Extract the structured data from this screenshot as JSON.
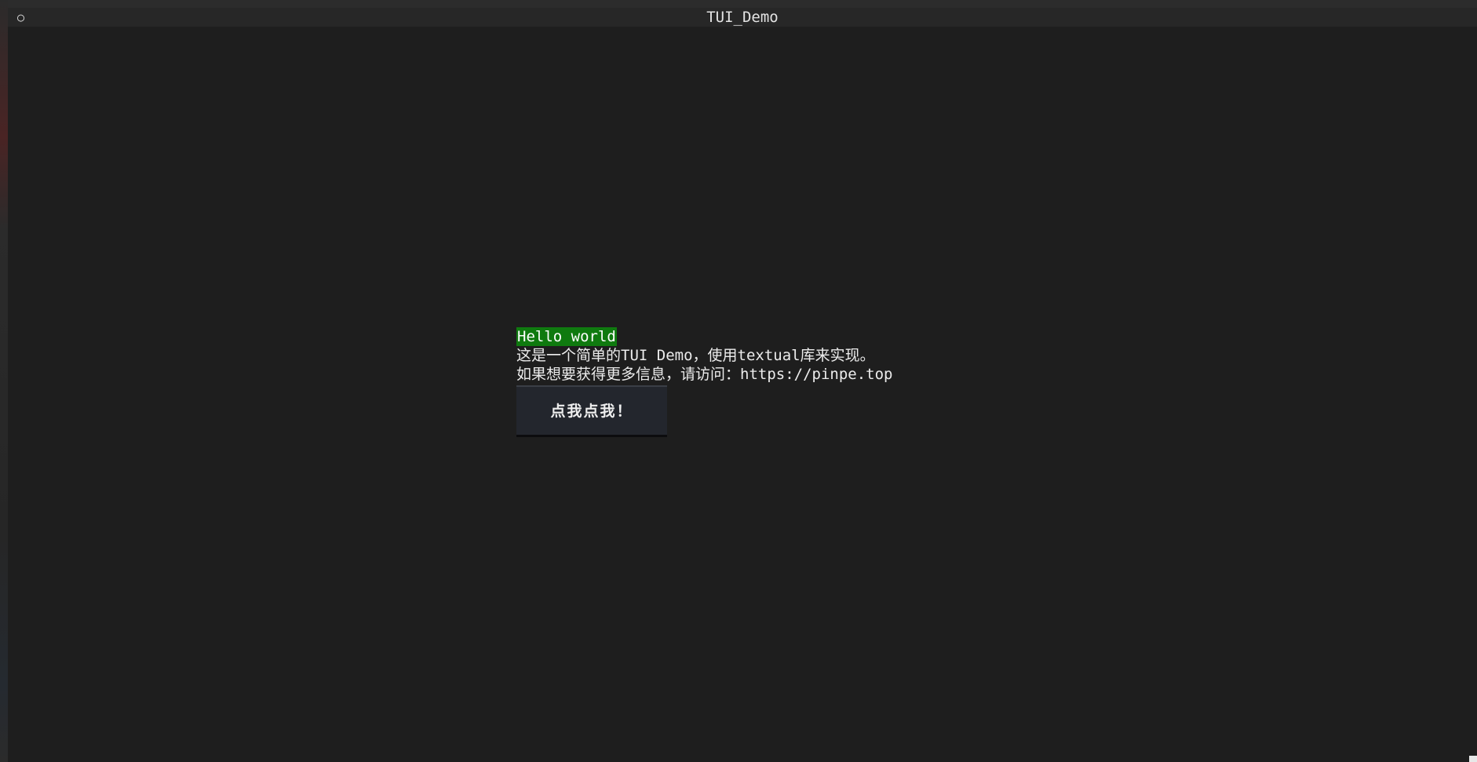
{
  "window": {
    "title": "TUI_Demo",
    "icon": "circle-icon",
    "icon_glyph": "○"
  },
  "main": {
    "hello_label": "Hello world",
    "description_line1": "这是一个简单的TUI Demo，使用textual库来实现。",
    "description_line2": "如果想要获得更多信息，请访问：https://pinpe.top",
    "button_label": "点我点我！"
  },
  "colors": {
    "background": "#1e1e1e",
    "hello_highlight": "#0f7a0f",
    "button_background": "#23262d",
    "text": "#ececec"
  }
}
